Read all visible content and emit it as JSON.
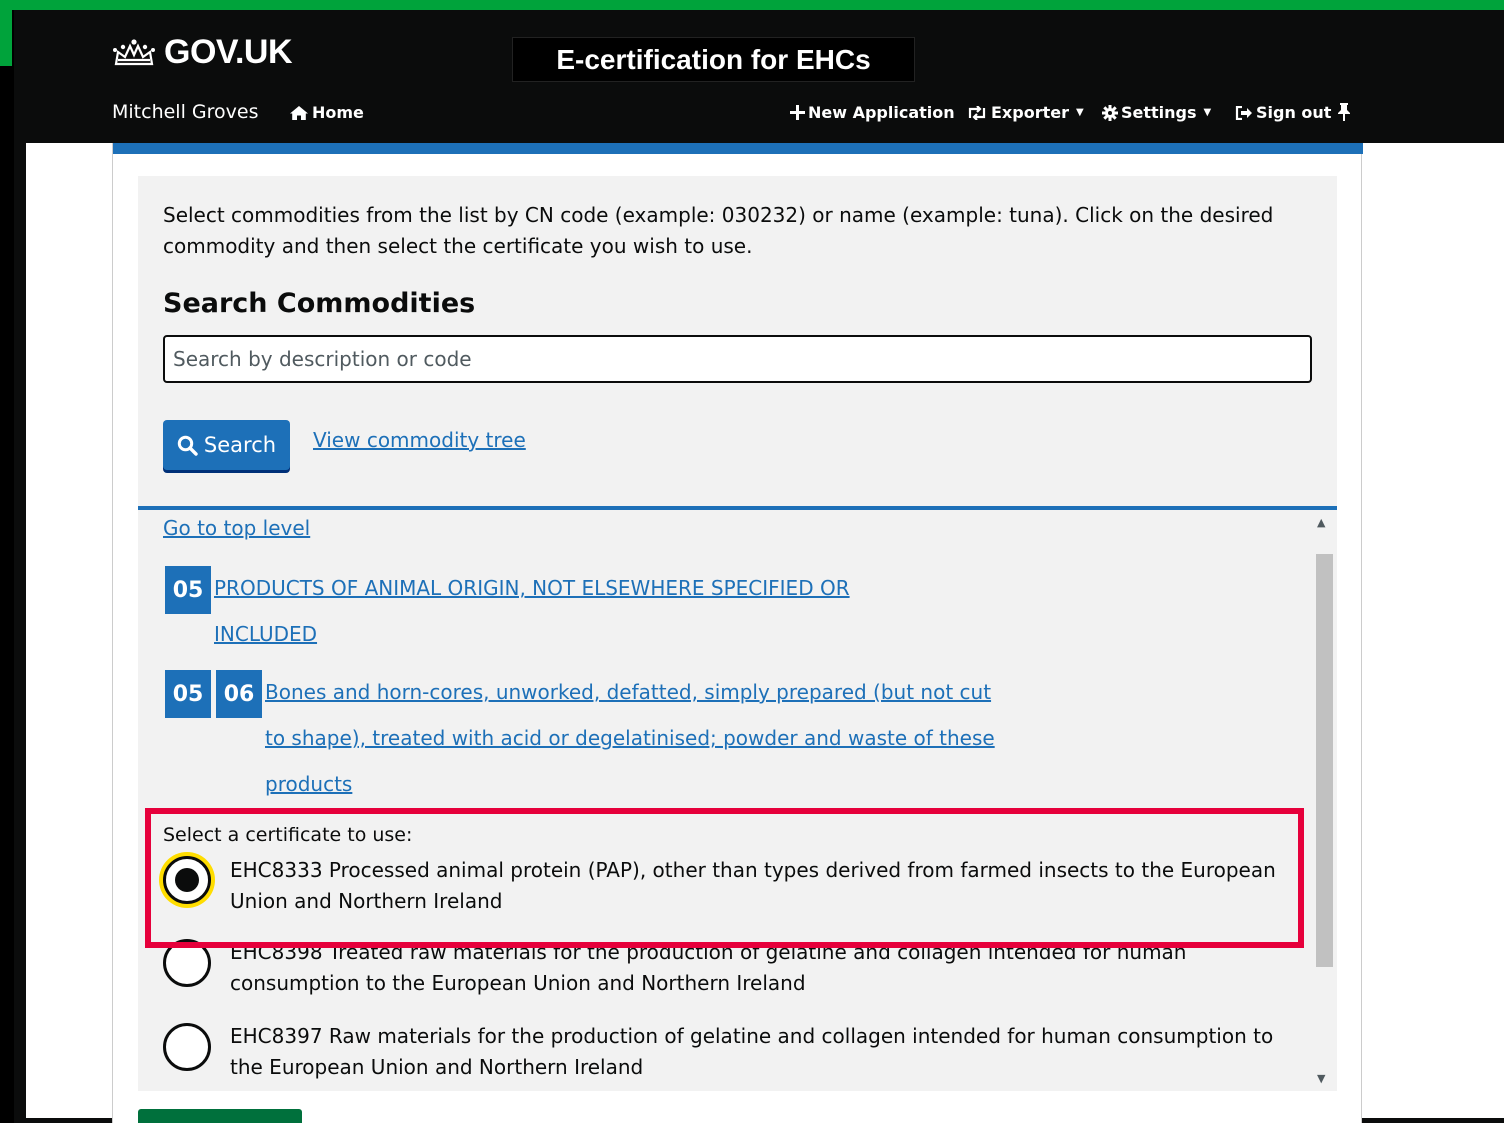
{
  "header": {
    "logo_text": "GOV.UK",
    "service_name": "E-certification for EHCs",
    "user_name": "Mitchell Groves",
    "nav": {
      "home": "Home",
      "new_application": "New Application",
      "exporter": "Exporter",
      "settings": "Settings",
      "sign_out": "Sign out"
    }
  },
  "search": {
    "intro": "Select commodities from the list by CN code (example: 030232) or name (example: tuna). Click on the desired commodity and then select the certificate you wish to use.",
    "heading": "Search Commodities",
    "placeholder": "Search by description or code",
    "button_label": "Search",
    "tree_link": "View commodity tree"
  },
  "commodity_list": {
    "top_level_link": "Go to top level",
    "level1": {
      "code": "05",
      "line1": "PRODUCTS OF ANIMAL ORIGIN, NOT ELSEWHERE SPECIFIED OR",
      "line2": "INCLUDED"
    },
    "level2": {
      "codes": [
        "05",
        "06"
      ],
      "line1": "Bones and horn-cores, unworked, defatted, simply prepared (but not cut",
      "line2": "to shape), treated with acid or degelatinised; powder and waste of these",
      "line3": "products"
    },
    "certificate_label": "Select a certificate to use:",
    "certificates": [
      {
        "label": "EHC8333 Processed animal protein (PAP), other than types derived from farmed insects to the European Union and Northern Ireland",
        "selected": true
      },
      {
        "label": "EHC8398 Treated raw materials for the production of gelatine and collagen intended for human consumption to the European Union and Northern Ireland",
        "selected": false
      },
      {
        "label": "EHC8397 Raw materials for the production of gelatine and collagen intended for human consumption to the European Union and Northern Ireland",
        "selected": false
      }
    ]
  },
  "colors": {
    "brand_blue": "#1d70b8",
    "header_black": "#0b0c0c",
    "highlight_red": "#e6003b",
    "focus_yellow": "#ffdd00",
    "gov_green": "#00a33b"
  }
}
